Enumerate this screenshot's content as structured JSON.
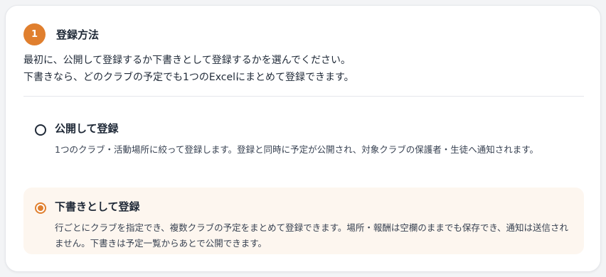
{
  "step": {
    "number": "1",
    "title": "登録方法"
  },
  "description": {
    "line1": "最初に、公開して登録するか下書きとして登録するかを選んでください。",
    "line2": "下書きなら、どのクラブの予定でも1つのExcelにまとめて登録できます。"
  },
  "options": [
    {
      "title": "公開して登録",
      "description": "1つのクラブ・活動場所に絞って登録します。登録と同時に予定が公開され、対象クラブの保護者・生徒へ通知されます。",
      "selected": false
    },
    {
      "title": "下書きとして登録",
      "description": "行ごとにクラブを指定でき、複数クラブの予定をまとめて登録できます。場所・報酬は空欄のままでも保存でき、通知は送信されません。下書きは予定一覧からあとで公開できます。",
      "selected": true
    }
  ],
  "colors": {
    "accent": "#e07f2e",
    "selected_bg": "#fdf6ef"
  }
}
